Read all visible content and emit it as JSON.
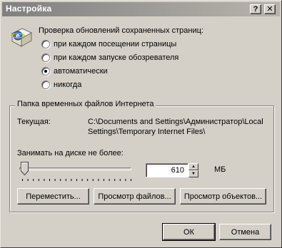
{
  "window": {
    "title": "Настройка",
    "help_glyph": "?",
    "close_glyph": "✕"
  },
  "check": {
    "heading": "Проверка обновлений сохраненных страниц:",
    "options": [
      {
        "label": "при каждом посещении страницы",
        "checked": false
      },
      {
        "label": "при каждом запуске обозревателя",
        "checked": false
      },
      {
        "label": "автоматически",
        "checked": true
      },
      {
        "label": "никогда",
        "checked": false
      }
    ]
  },
  "temp_folder": {
    "group_title": "Папка временных файлов Интернета",
    "current_label": "Текущая:",
    "current_path_line1": "C:\\Documents and Settings\\Администратор\\Local",
    "current_path_line2": "Settings\\Temporary Internet Files\\",
    "disk_label": "Занимать на диске не более:",
    "disk_value": "610",
    "disk_unit": "МБ",
    "slider_level": 0.06
  },
  "buttons": {
    "move": "Переместить...",
    "view_files": "Просмотр файлов...",
    "view_objects": "Просмотр объектов...",
    "ok": "ОК",
    "cancel": "Отмена"
  },
  "icons": {
    "app": "ie-page-icon",
    "help": "help-icon",
    "close": "close-icon",
    "slider": "slider-thumb-icon",
    "spin_up": "arrow-up-icon",
    "spin_down": "arrow-down-icon"
  }
}
